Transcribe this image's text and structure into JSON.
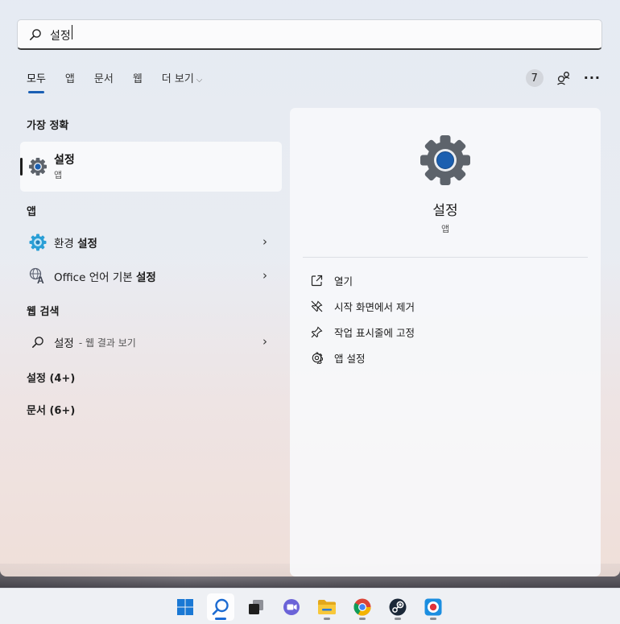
{
  "search": {
    "value": "설정",
    "icon": "search-icon"
  },
  "tabs": [
    {
      "label": "모두",
      "active": true
    },
    {
      "label": "앱"
    },
    {
      "label": "문서"
    },
    {
      "label": "웹"
    },
    {
      "label": "더 보기"
    }
  ],
  "toolbar": {
    "badge": "7",
    "more": "···"
  },
  "sections": {
    "best_match": "가장 정확",
    "apps": "앱",
    "web": "웹 검색",
    "settings_more": "설정 (4+)",
    "docs_more": "문서 (6+)"
  },
  "best_match": {
    "title": "설정",
    "subtitle": "앱"
  },
  "apps": [
    {
      "prefix": "환경 ",
      "bold": "설정"
    },
    {
      "prefix": "Office 언어 기본 ",
      "bold": "설정"
    }
  ],
  "web_result": {
    "label": "설정",
    "sub": "- 웹 결과 보기"
  },
  "detail": {
    "name": "설정",
    "type": "앱",
    "actions": [
      {
        "label": "열기",
        "icon": "open-icon"
      },
      {
        "label": "시작 화면에서 제거",
        "icon": "unpin-icon"
      },
      {
        "label": "작업 표시줄에 고정",
        "icon": "pin-icon"
      },
      {
        "label": "앱 설정",
        "icon": "gear-icon"
      }
    ]
  },
  "colors": {
    "accent": "#1a5fb4",
    "gear": "#5d636b",
    "gear_center": "#1b5fb0"
  }
}
